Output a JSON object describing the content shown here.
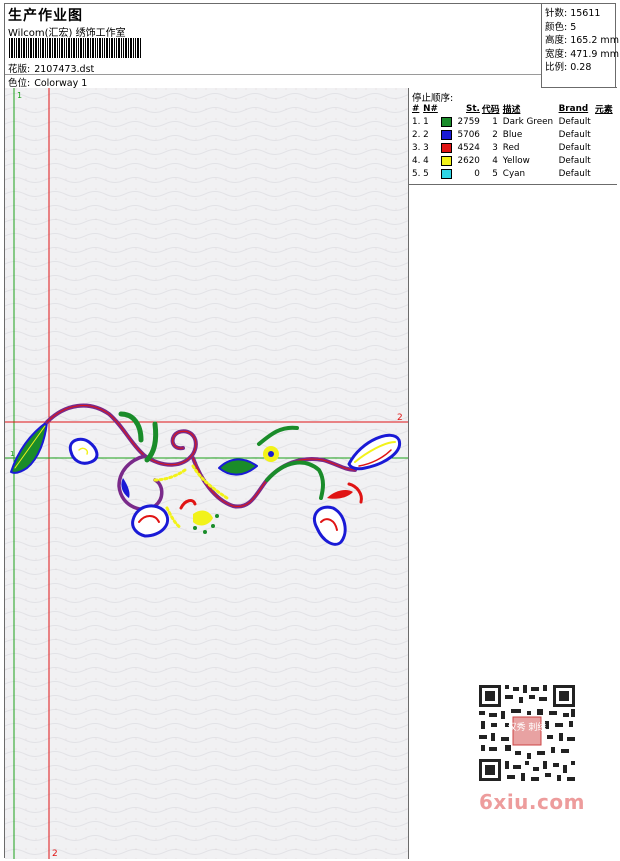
{
  "header": {
    "title": "生产作业图",
    "subtitle": "Wilcom(汇宏) 绣饰工作室",
    "design_label": "花版:",
    "design_value": "2107473.dst",
    "colorway_label": "色位:",
    "colorway_value": "Colorway 1"
  },
  "info": {
    "stitches": "针数: 15611",
    "colors": "颜色: 5",
    "height": "高度: 165.2 mm",
    "width": "宽度: 471.9 mm",
    "scale": "比例: 0.28"
  },
  "canvas": {
    "marker_top": "1",
    "marker_right": "2",
    "marker_bottom": "2",
    "marker_left_small": "1"
  },
  "stop_sequence": {
    "title": "停止顺序:",
    "headers": [
      "#",
      "N#",
      "St.",
      "代码",
      "描述",
      "Brand",
      "元素"
    ],
    "rows": [
      {
        "idx": "1.",
        "n": "1",
        "color": "#1a8c2a",
        "st": "2759",
        "code": "1",
        "desc": "Dark Green",
        "brand": "Default",
        "elem": ""
      },
      {
        "idx": "2.",
        "n": "2",
        "color": "#1a1ad6",
        "st": "5706",
        "code": "2",
        "desc": "Blue",
        "brand": "Default",
        "elem": ""
      },
      {
        "idx": "3.",
        "n": "3",
        "color": "#e01414",
        "st": "4524",
        "code": "3",
        "desc": "Red",
        "brand": "Default",
        "elem": ""
      },
      {
        "idx": "4.",
        "n": "4",
        "color": "#f2f21a",
        "st": "2620",
        "code": "4",
        "desc": "Yellow",
        "brand": "Default",
        "elem": ""
      },
      {
        "idx": "5.",
        "n": "5",
        "color": "#2fd6e6",
        "st": "0",
        "code": "5",
        "desc": "Cyan",
        "brand": "Default",
        "elem": ""
      }
    ]
  },
  "watermark": {
    "site": "6xiu.com",
    "qr_badge": "汉秀 刺绣"
  }
}
